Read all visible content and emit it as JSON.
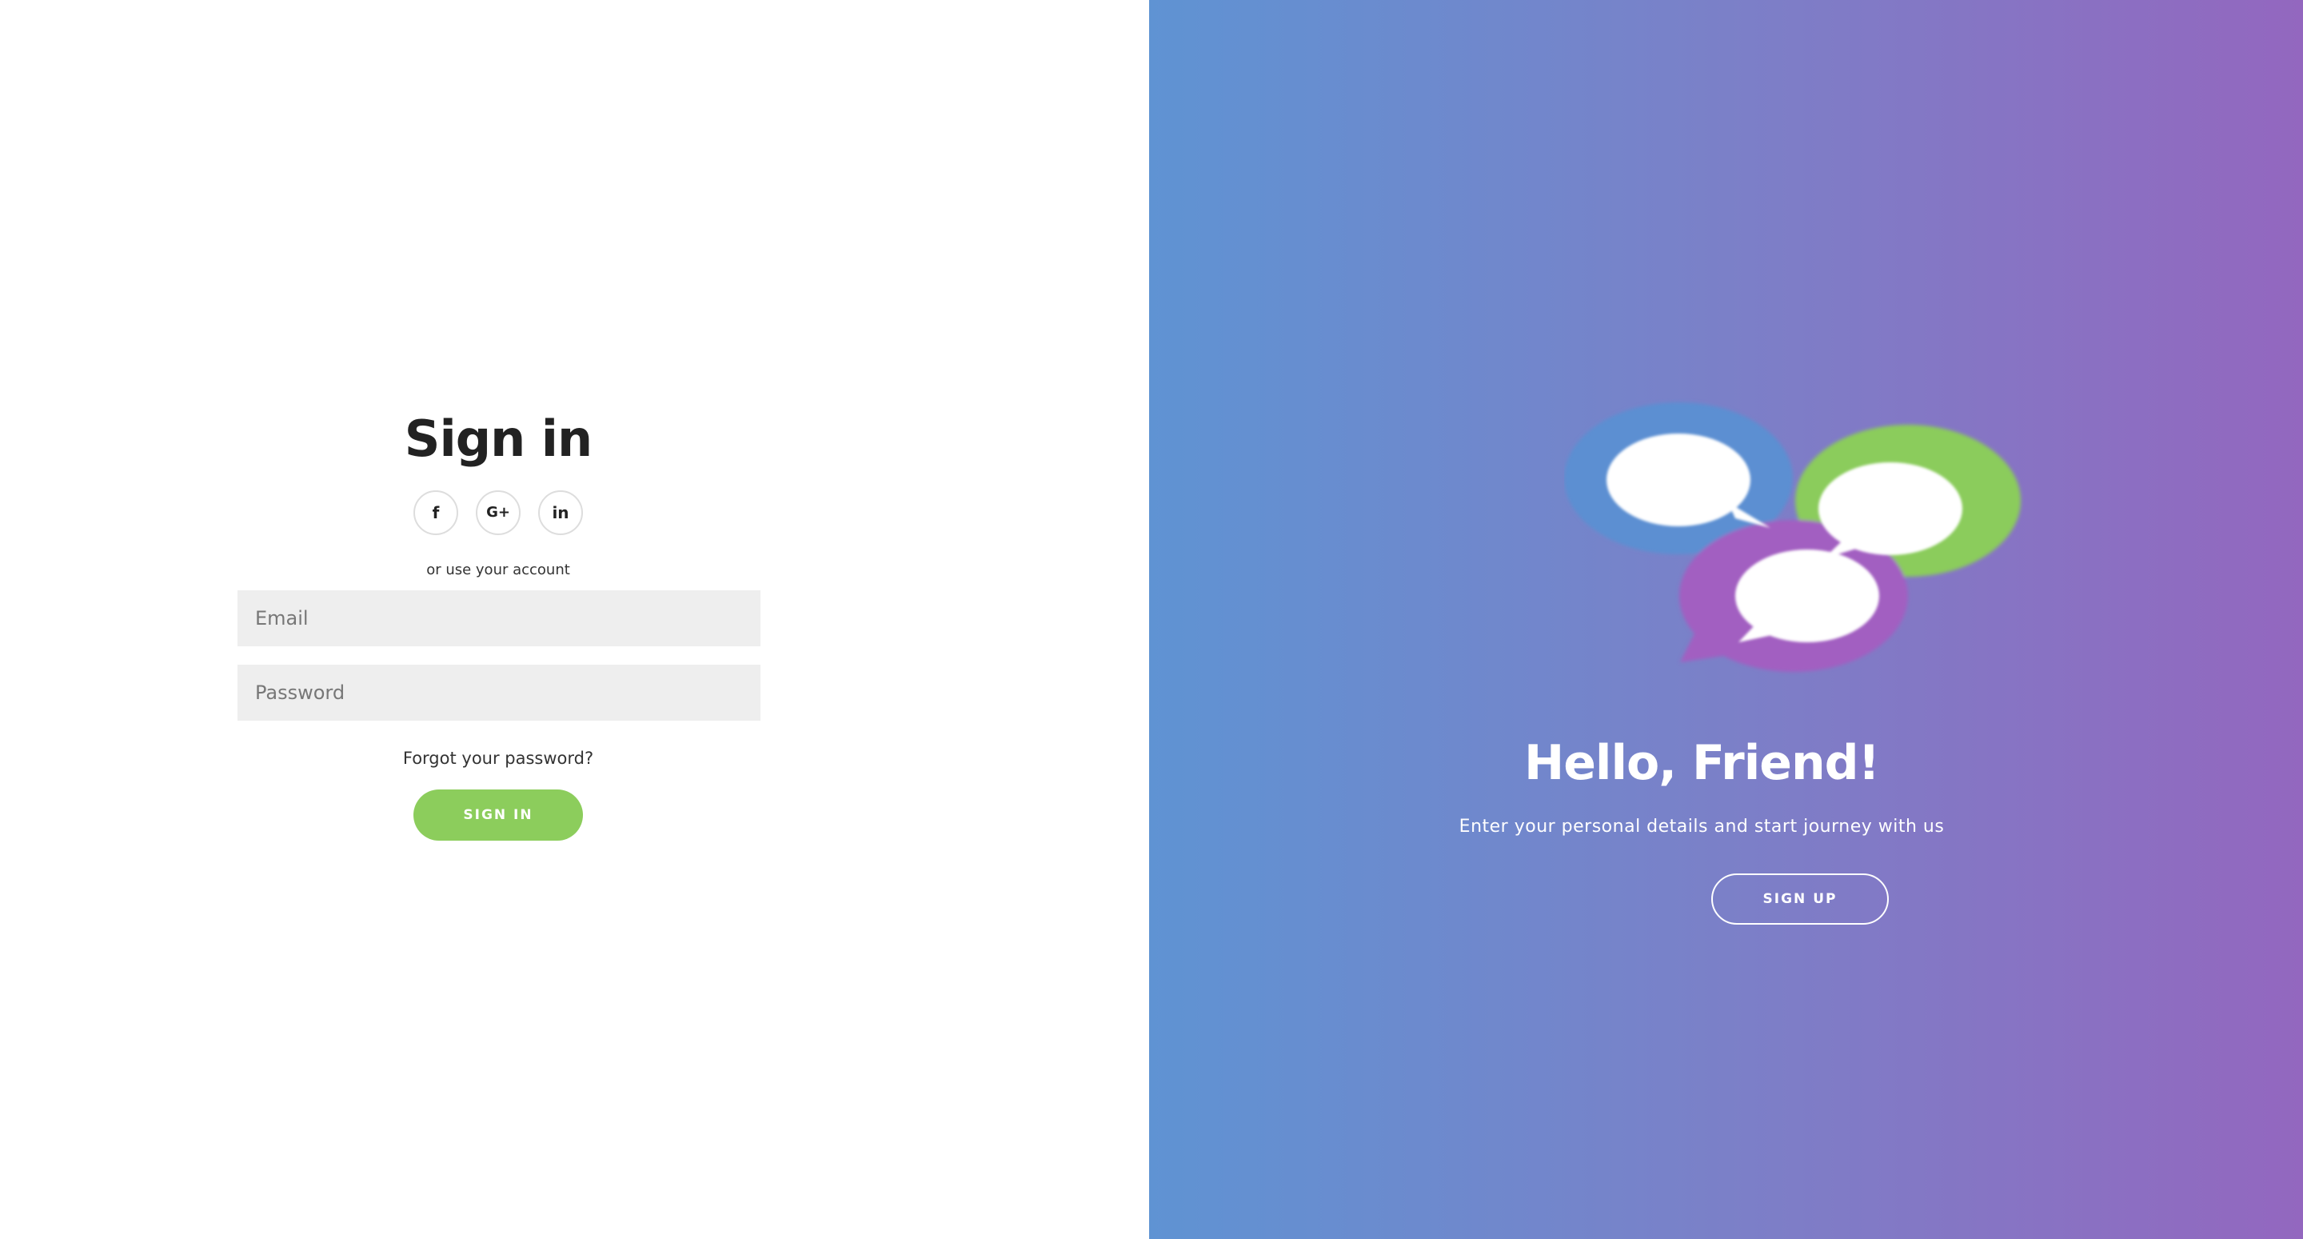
{
  "signin": {
    "title": "Sign in",
    "social": [
      {
        "icon": "facebook-icon",
        "glyph": "f"
      },
      {
        "icon": "google-plus-icon",
        "glyph": "G+"
      },
      {
        "icon": "linkedin-icon",
        "glyph": "in"
      }
    ],
    "alt_text": "or use your account",
    "email_placeholder": "Email",
    "password_placeholder": "Password",
    "forgot_label": "Forgot your password?",
    "button_label": "SIGN IN"
  },
  "signup": {
    "title": "Hello, Friend!",
    "subtitle": "Enter your personal details and start journey with us",
    "button_label": "SIGN UP",
    "illustration_icon": "chat-bubbles-icon"
  },
  "colors": {
    "accent_green": "#8ccd5c",
    "gradient_start": "#5f93d3",
    "gradient_end": "#9367bf",
    "bubble_blue": "#5b8fd2",
    "bubble_green": "#8bcc5b",
    "bubble_purple": "#a25fc1"
  }
}
